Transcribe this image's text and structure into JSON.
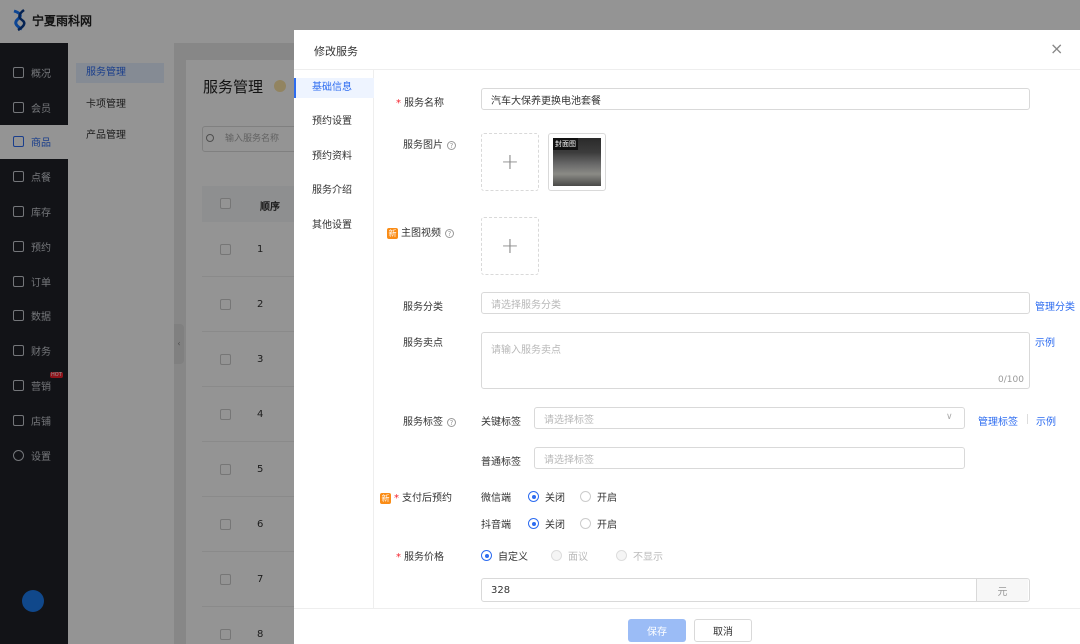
{
  "app": {
    "brand": "宁夏雨科网"
  },
  "nav": {
    "items": [
      {
        "label": "概况",
        "icon": "grid-icon"
      },
      {
        "label": "会员",
        "icon": "crown-icon"
      },
      {
        "label": "商品",
        "icon": "store-icon",
        "active": true
      },
      {
        "label": "点餐",
        "icon": "dish-icon"
      },
      {
        "label": "库存",
        "icon": "warehouse-icon"
      },
      {
        "label": "预约",
        "icon": "calendar-check-icon"
      },
      {
        "label": "订单",
        "icon": "order-icon"
      },
      {
        "label": "数据",
        "icon": "chart-icon"
      },
      {
        "label": "财务",
        "icon": "finance-icon"
      },
      {
        "label": "营销",
        "icon": "marketing-icon",
        "badge": "HOT"
      },
      {
        "label": "店铺",
        "icon": "shop-icon"
      },
      {
        "label": "设置",
        "icon": "gear-icon"
      }
    ]
  },
  "subnav": {
    "items": [
      "服务管理",
      "卡项管理",
      "产品管理"
    ]
  },
  "page": {
    "title": "服务管理",
    "search_placeholder": "输入服务名称",
    "table_header": "顺序",
    "rows": [
      "1",
      "2",
      "3",
      "4",
      "5",
      "6",
      "7",
      "8"
    ]
  },
  "modal": {
    "title": "修改服务",
    "close": "×",
    "tabs": [
      "基础信息",
      "预约设置",
      "预约资料",
      "服务介绍",
      "其他设置"
    ],
    "fields": {
      "name_label": "服务名称",
      "name_value": "汽车大保养更换电池套餐",
      "image_label": "服务图片",
      "image_badge": "封面图",
      "video_label": "主图视频",
      "new_tag": "新",
      "category_label": "服务分类",
      "category_placeholder": "请选择服务分类",
      "category_link": "管理分类",
      "selling_label": "服务卖点",
      "selling_placeholder": "请输入服务卖点",
      "selling_counter": "0/100",
      "selling_link": "示例",
      "tags_label": "服务标签",
      "key_tag_label": "关键标签",
      "key_tag_placeholder": "请选择标签",
      "manage_tags_link": "管理标签",
      "tags_example_link": "示例",
      "normal_tag_label": "普通标签",
      "normal_tag_placeholder": "请选择标签",
      "booking_label": "支付后预约",
      "wechat_label": "微信端",
      "douyin_label": "抖音端",
      "off": "关闭",
      "on": "开启",
      "price_label": "服务价格",
      "price_custom": "自定义",
      "price_negotiable": "面议",
      "price_hidden": "不显示",
      "price_value": "328",
      "price_unit": "元",
      "help_mark": "?"
    },
    "footer": {
      "save": "保存",
      "cancel": "取消"
    }
  }
}
